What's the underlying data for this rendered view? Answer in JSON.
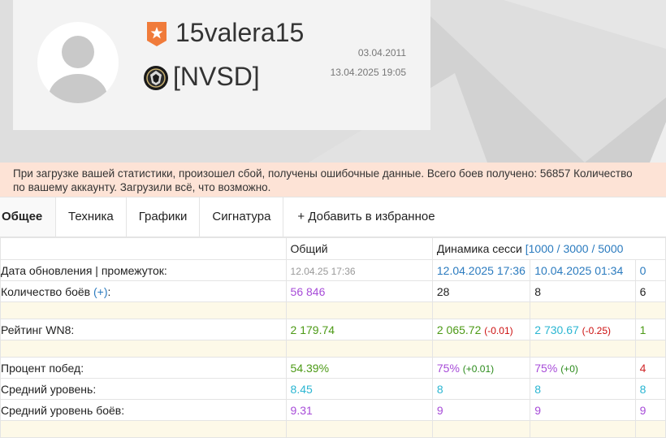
{
  "profile": {
    "username": "15valera15",
    "clan_tag": "[NVSD]",
    "date_created": "03.04.2011",
    "date_last": "13.04.2025 19:05"
  },
  "alert": {
    "line1": "При загрузке вашей статистики, произошел сбой, получены ошибочные данные. Всего боев получено: 56857 Количество",
    "line2": "по вашему аккаунту. Загрузили всё, что возможно."
  },
  "tabs": [
    "Общее",
    "Техника",
    "Графики",
    "Сигнатура",
    "+ Добавить в избранное"
  ],
  "table": {
    "headers": {
      "total": "Общий",
      "session": "Динамика сесси",
      "ranges": "[1000 / 3000 / 5000"
    },
    "rows": {
      "update": {
        "label": "Дата обновления | промежуток:",
        "total": "12.04.25 17:36",
        "c1": "12.04.2025 17:36",
        "c2": "10.04.2025 01:34",
        "c3": "0"
      },
      "battles": {
        "label": "Количество боёв",
        "plus": "(+)",
        "colon": ":",
        "total": "56 846",
        "c1": "28",
        "c2": "8",
        "c3": "6"
      },
      "wn8": {
        "label": "Рейтинг WN8:",
        "total": "2 179.74",
        "c1": "2 065.72",
        "c1_delta": "(-0.01)",
        "c2": "2 730.67",
        "c2_delta": "(-0.25)",
        "c3": "1"
      },
      "winrate": {
        "label": "Процент побед:",
        "total": "54.39%",
        "c1": "75%",
        "c1_delta": "(+0.01)",
        "c2": "75%",
        "c2_delta": "(+0)",
        "c3": "4"
      },
      "avg_level": {
        "label": "Средний уровень:",
        "total": "8.45",
        "c1": "8",
        "c2": "8",
        "c3": "8"
      },
      "avg_battle_level": {
        "label": "Средний уровень боёв:",
        "total": "9.31",
        "c1": "9",
        "c2": "9",
        "c3": "9"
      }
    }
  },
  "colors": {
    "alert_bg": "#fde3d6",
    "spacer_bg": "#fdf9e8",
    "purple": "#a74cd8",
    "green": "#4c9a16",
    "cyan": "#2bb6d2",
    "blue": "#2b7bbf",
    "rank_icon": "#f07b3a"
  },
  "icons": [
    "default-avatar-icon",
    "rank-badge-icon",
    "clan-emblem-icon"
  ]
}
